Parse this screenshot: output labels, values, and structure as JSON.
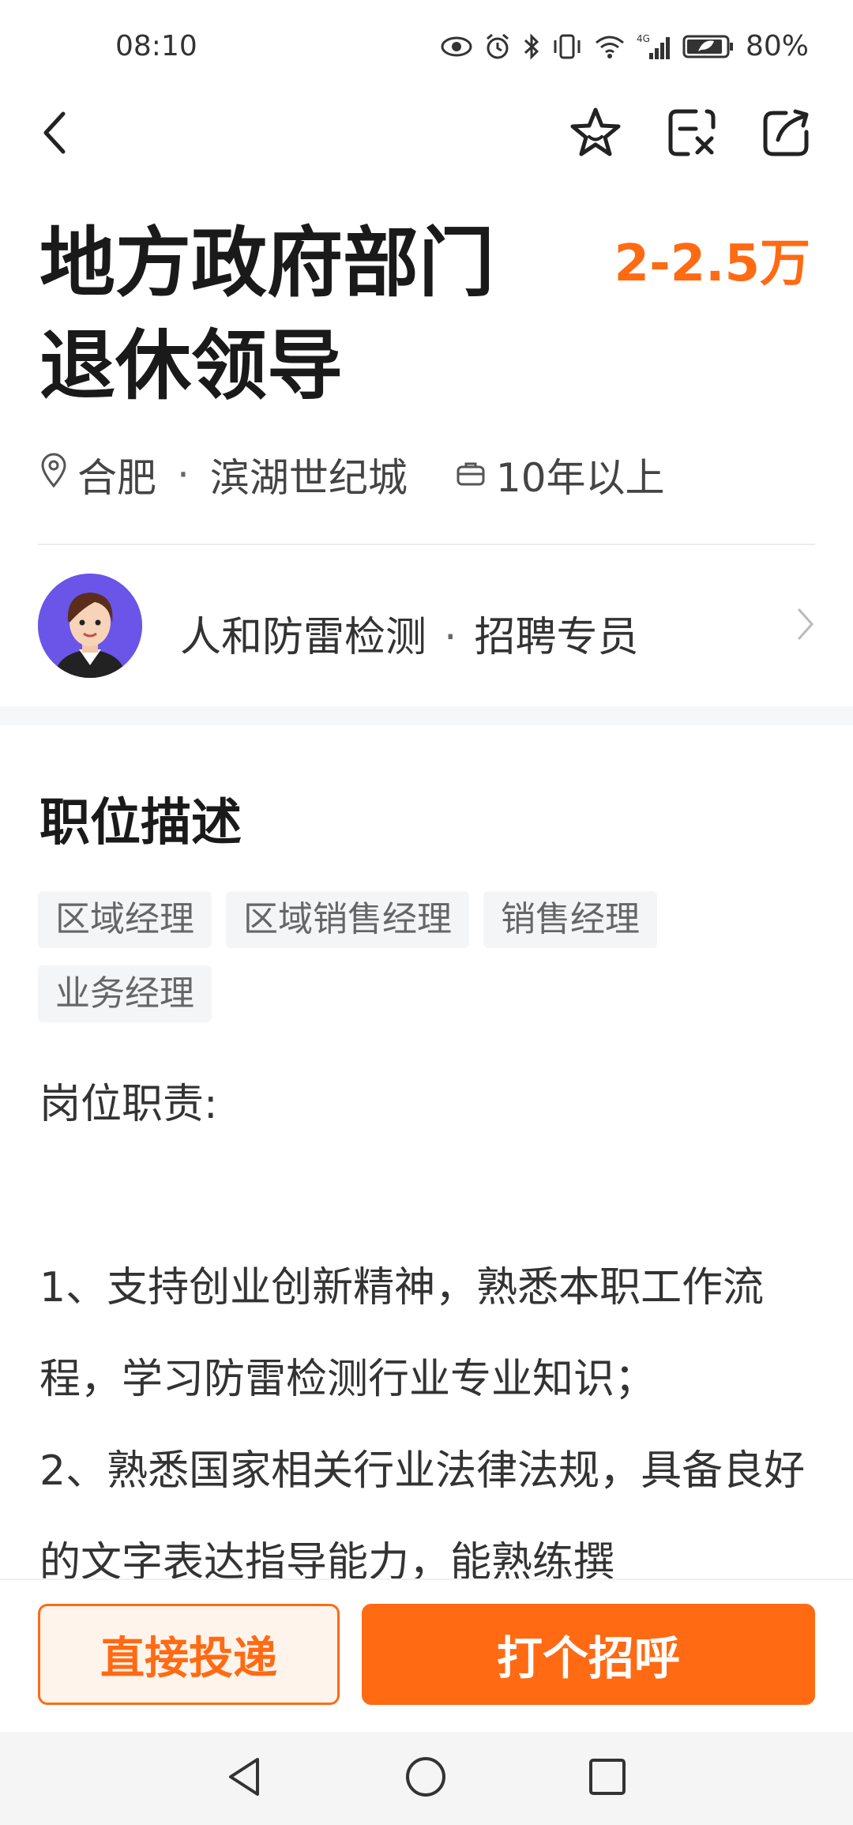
{
  "status_bar": {
    "time": "08:10",
    "battery": "80%",
    "network": "4G"
  },
  "topbar": {
    "icons": [
      "back-icon",
      "favorite-icon",
      "report-icon",
      "share-icon"
    ]
  },
  "job": {
    "title": "地方政府部门退休领导",
    "salary": "2-2.5万",
    "city": "合肥",
    "district": "滨湖世纪城",
    "experience": "10年以上"
  },
  "recruiter": {
    "company": "人和防雷检测",
    "role": "招聘专员",
    "separator": "·"
  },
  "description": {
    "section_title": "职位描述",
    "tags": [
      "区域经理",
      "区域销售经理",
      "销售经理",
      "业务经理"
    ],
    "text": "岗位职责:\n\n1、支持创业创新精神，熟悉本职工作流程，学习防雷检测行业专业知识；\n2、熟悉国家相关行业法律法规，具备良好的文字表达指导能力，能熟练撰"
  },
  "actions": {
    "apply_label": "直接投递",
    "greet_label": "打个招呼"
  },
  "colors": {
    "accent": "#ff6a13",
    "text": "#1a1a1a"
  }
}
